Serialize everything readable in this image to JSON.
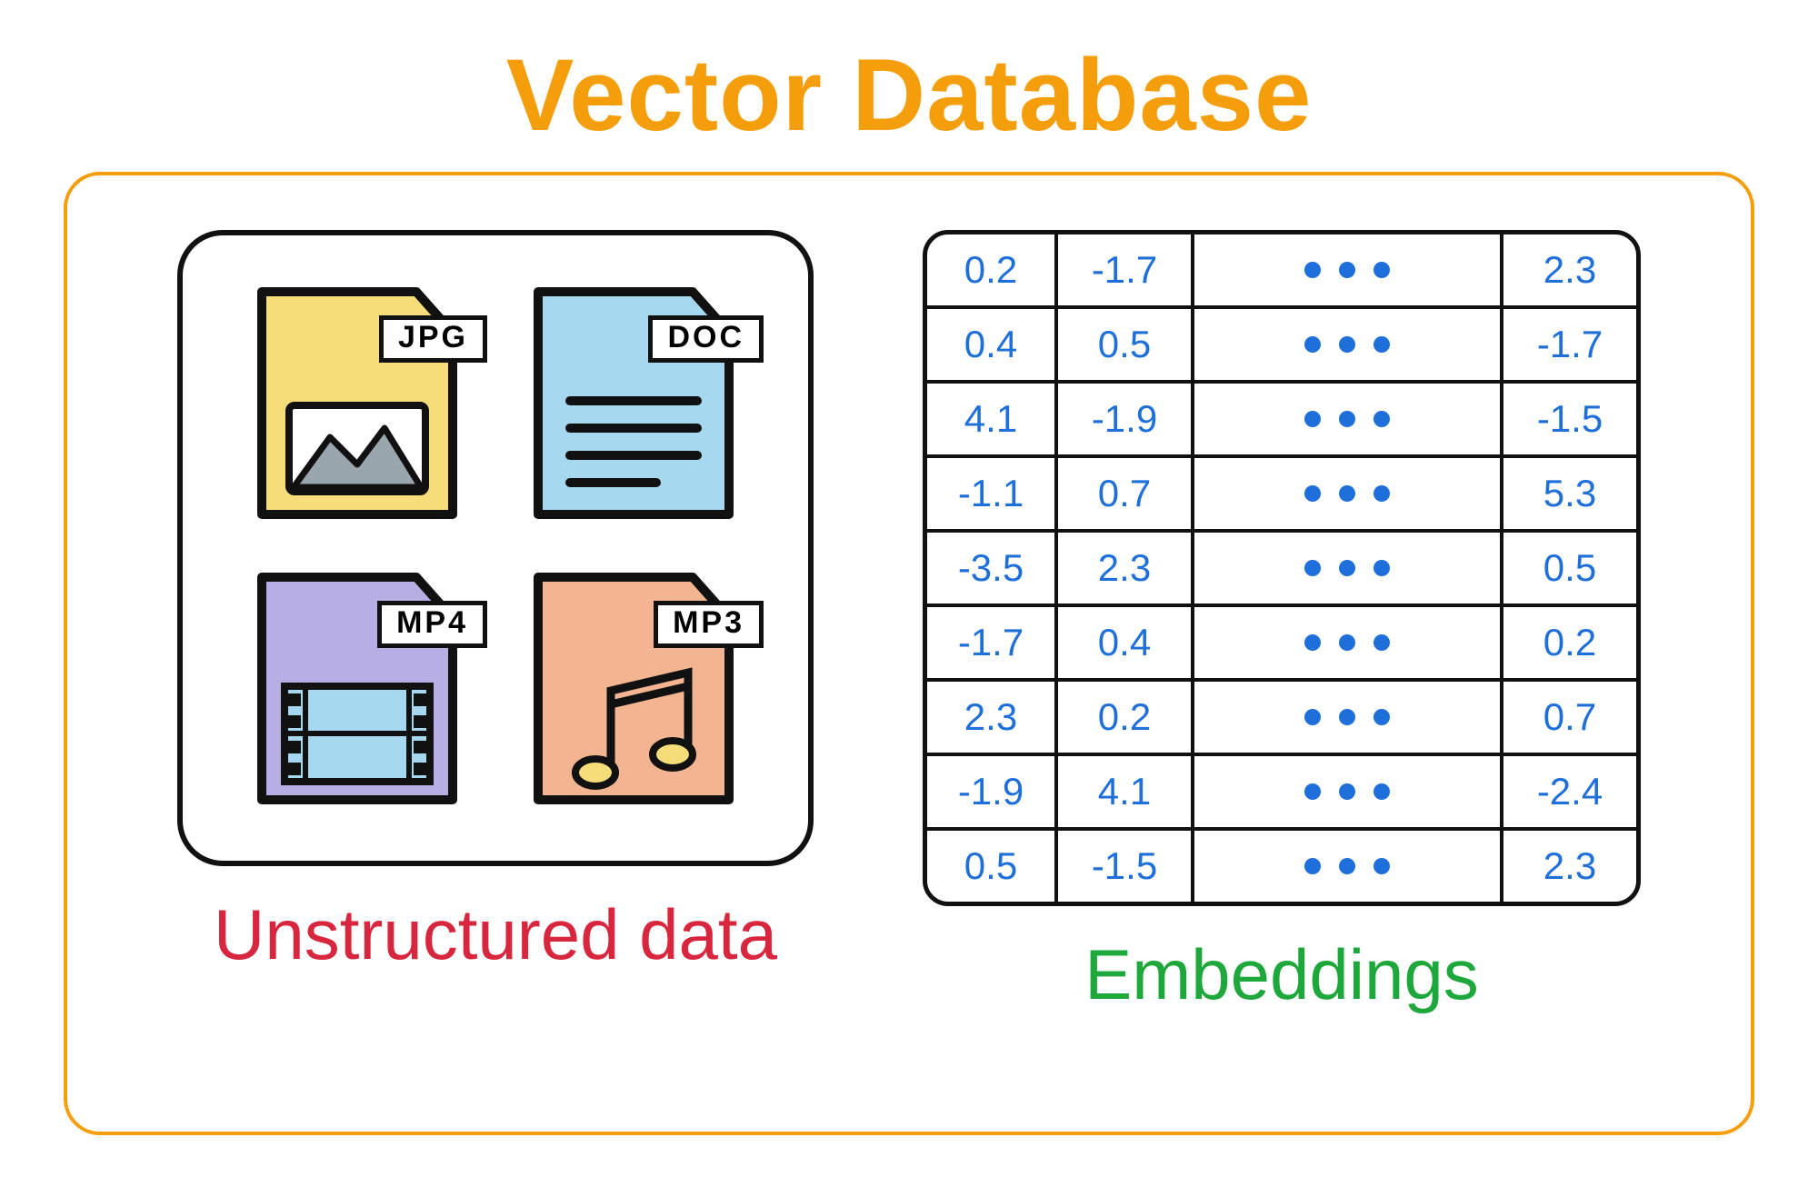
{
  "title": "Vector Database",
  "left": {
    "caption": "Unstructured data",
    "files": [
      {
        "tag": "JPG",
        "fill": "#f6dd7a"
      },
      {
        "tag": "DOC",
        "fill": "#a6d8ef"
      },
      {
        "tag": "MP4",
        "fill": "#b7aee3"
      },
      {
        "tag": "MP3",
        "fill": "#f3b591"
      }
    ]
  },
  "right": {
    "caption": "Embeddings",
    "rows": [
      {
        "a": "0.2",
        "b": "-1.7",
        "c": "2.3"
      },
      {
        "a": "0.4",
        "b": "0.5",
        "c": "-1.7"
      },
      {
        "a": "4.1",
        "b": "-1.9",
        "c": "-1.5"
      },
      {
        "a": "-1.1",
        "b": "0.7",
        "c": "5.3"
      },
      {
        "a": "-3.5",
        "b": "2.3",
        "c": "0.5"
      },
      {
        "a": "-1.7",
        "b": "0.4",
        "c": "0.2"
      },
      {
        "a": "2.3",
        "b": "0.2",
        "c": "0.7"
      },
      {
        "a": "-1.9",
        "b": "4.1",
        "c": "-2.4"
      },
      {
        "a": "0.5",
        "b": "-1.5",
        "c": "2.3"
      }
    ]
  }
}
